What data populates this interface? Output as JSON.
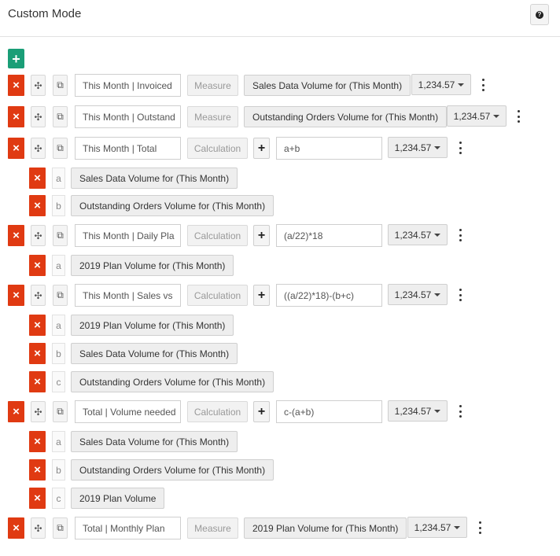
{
  "header": {
    "title": "Custom Mode",
    "help_label": "?"
  },
  "toolbar": {
    "add_label": "+"
  },
  "icons": {
    "delete": "×",
    "move": "✣",
    "copy": "⧉",
    "plus": "+"
  },
  "rows": [
    {
      "name": "This Month | Invoiced",
      "type": "Measure",
      "measure": "Sales Data Volume for (This Month)",
      "format": "1,234.57"
    },
    {
      "name": "This Month | Outstand",
      "type": "Measure",
      "measure": "Outstanding Orders Volume for (This Month)",
      "format": "1,234.57"
    },
    {
      "name": "This Month | Total",
      "type": "Calculation",
      "formula": "a+b",
      "format": "1,234.57",
      "vars": [
        {
          "letter": "a",
          "label": "Sales Data Volume for (This Month)"
        },
        {
          "letter": "b",
          "label": "Outstanding Orders Volume for (This Month)"
        }
      ]
    },
    {
      "name": "This Month | Daily Pla",
      "type": "Calculation",
      "formula": "(a/22)*18",
      "format": "1,234.57",
      "vars": [
        {
          "letter": "a",
          "label": "2019 Plan Volume for (This Month)"
        }
      ]
    },
    {
      "name": "This Month | Sales vs",
      "type": "Calculation",
      "formula": "((a/22)*18)-(b+c)",
      "format": "1,234.57",
      "vars": [
        {
          "letter": "a",
          "label": "2019 Plan Volume for (This Month)"
        },
        {
          "letter": "b",
          "label": "Sales Data Volume for (This Month)"
        },
        {
          "letter": "c",
          "label": "Outstanding Orders Volume for (This Month)"
        }
      ]
    },
    {
      "name": "Total | Volume needed",
      "type": "Calculation",
      "formula": "c-(a+b)",
      "format": "1,234.57",
      "vars": [
        {
          "letter": "a",
          "label": "Sales Data Volume for (This Month)"
        },
        {
          "letter": "b",
          "label": "Outstanding Orders Volume for (This Month)"
        },
        {
          "letter": "c",
          "label": "2019 Plan Volume"
        }
      ]
    },
    {
      "name": "Total | Monthly Plan",
      "type": "Measure",
      "measure": "2019 Plan Volume for (This Month)",
      "format": "1,234.57"
    }
  ],
  "colors": {
    "delete": "#e03a12",
    "add": "#1a9e77"
  }
}
